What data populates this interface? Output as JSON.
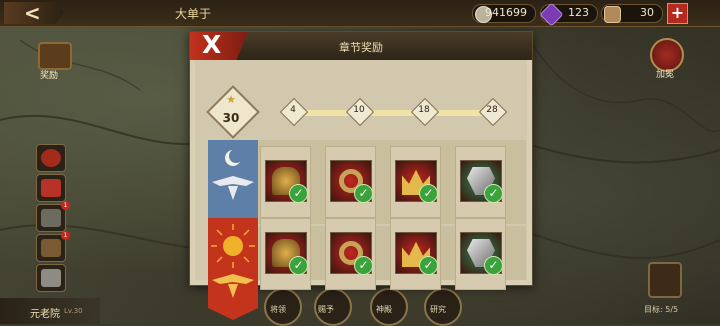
{
  "top_bar": {
    "back_glyph": "<",
    "area_title": "大单于",
    "resources": [
      {
        "icon": "silver-coin-icon",
        "value": "941699",
        "color": "#b9b29d"
      },
      {
        "icon": "purple-gem-icon",
        "value": "123",
        "color": "#7a3bb5"
      },
      {
        "icon": "helmet-icon",
        "value": "30",
        "color": "#b08a5a"
      }
    ],
    "plus_glyph": "+"
  },
  "left_panel": {
    "chest_label": "奖励",
    "senate_name": "元老院",
    "senate_level": "Lv.30",
    "badges": [
      "1",
      "1"
    ]
  },
  "right_panel": {
    "crown_label": "加冕",
    "chest_progress": "目标: 5/5"
  },
  "dialog": {
    "title": "章节奖励",
    "close_glyph": "X",
    "stars": "30",
    "star_glyph": "★",
    "progress": 1.0,
    "milestones": [
      "4",
      "10",
      "18",
      "28"
    ],
    "rewards": [
      [
        {
          "item": "spartan-helmet-icon",
          "tile": "#c4261f",
          "claimed": true
        },
        {
          "item": "gold-ring-icon",
          "tile": "#c4261f",
          "claimed": true
        },
        {
          "item": "crown-icon",
          "tile": "#c4261f",
          "claimed": true
        },
        {
          "item": "armor-banner-icon",
          "tile": "#2f8a52",
          "claimed": true
        }
      ],
      [
        {
          "item": "spartan-helmet-icon",
          "tile": "#c4261f",
          "claimed": true
        },
        {
          "item": "gold-ring-icon",
          "tile": "#c4261f",
          "claimed": true
        },
        {
          "item": "crown-icon",
          "tile": "#c4261f",
          "claimed": true
        },
        {
          "item": "armor-banner-icon",
          "tile": "#2f8a52",
          "claimed": true
        }
      ]
    ],
    "check_glyph": "✓"
  },
  "bottom_bar": {
    "medal_labels": [
      "将领",
      "赐予",
      "神殿",
      "研究"
    ]
  }
}
